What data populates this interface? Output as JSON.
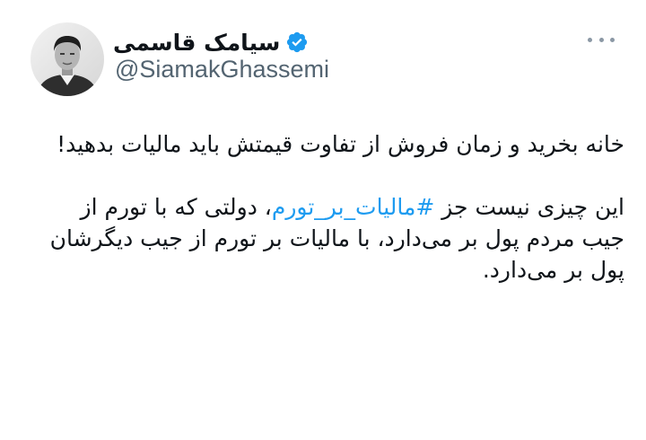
{
  "author": {
    "name": "سیامک قاسمی",
    "handle": "@SiamakGhassemi",
    "verified": true,
    "verified_icon": "verified-badge-icon",
    "avatar": "profile-photo"
  },
  "menu": {
    "icon": "more-options-icon"
  },
  "tweet": {
    "paragraph1": "خانه بخرید و زمان فروش از تفاوت قیمتش باید مالیات بدهید!",
    "paragraph2_before": "این چیزی نیست جز ",
    "hashtag": "#مالیات_بر_تورم",
    "paragraph2_after": "، دولتی که با تورم از جیب مردم پول بر می‌دارد، با مالیات بر تورم از جیب دیگرشان پول بر می‌دارد."
  },
  "colors": {
    "text": "#0f1419",
    "secondary": "#536471",
    "link": "#1d9bf0",
    "verified": "#1d9bf0"
  }
}
